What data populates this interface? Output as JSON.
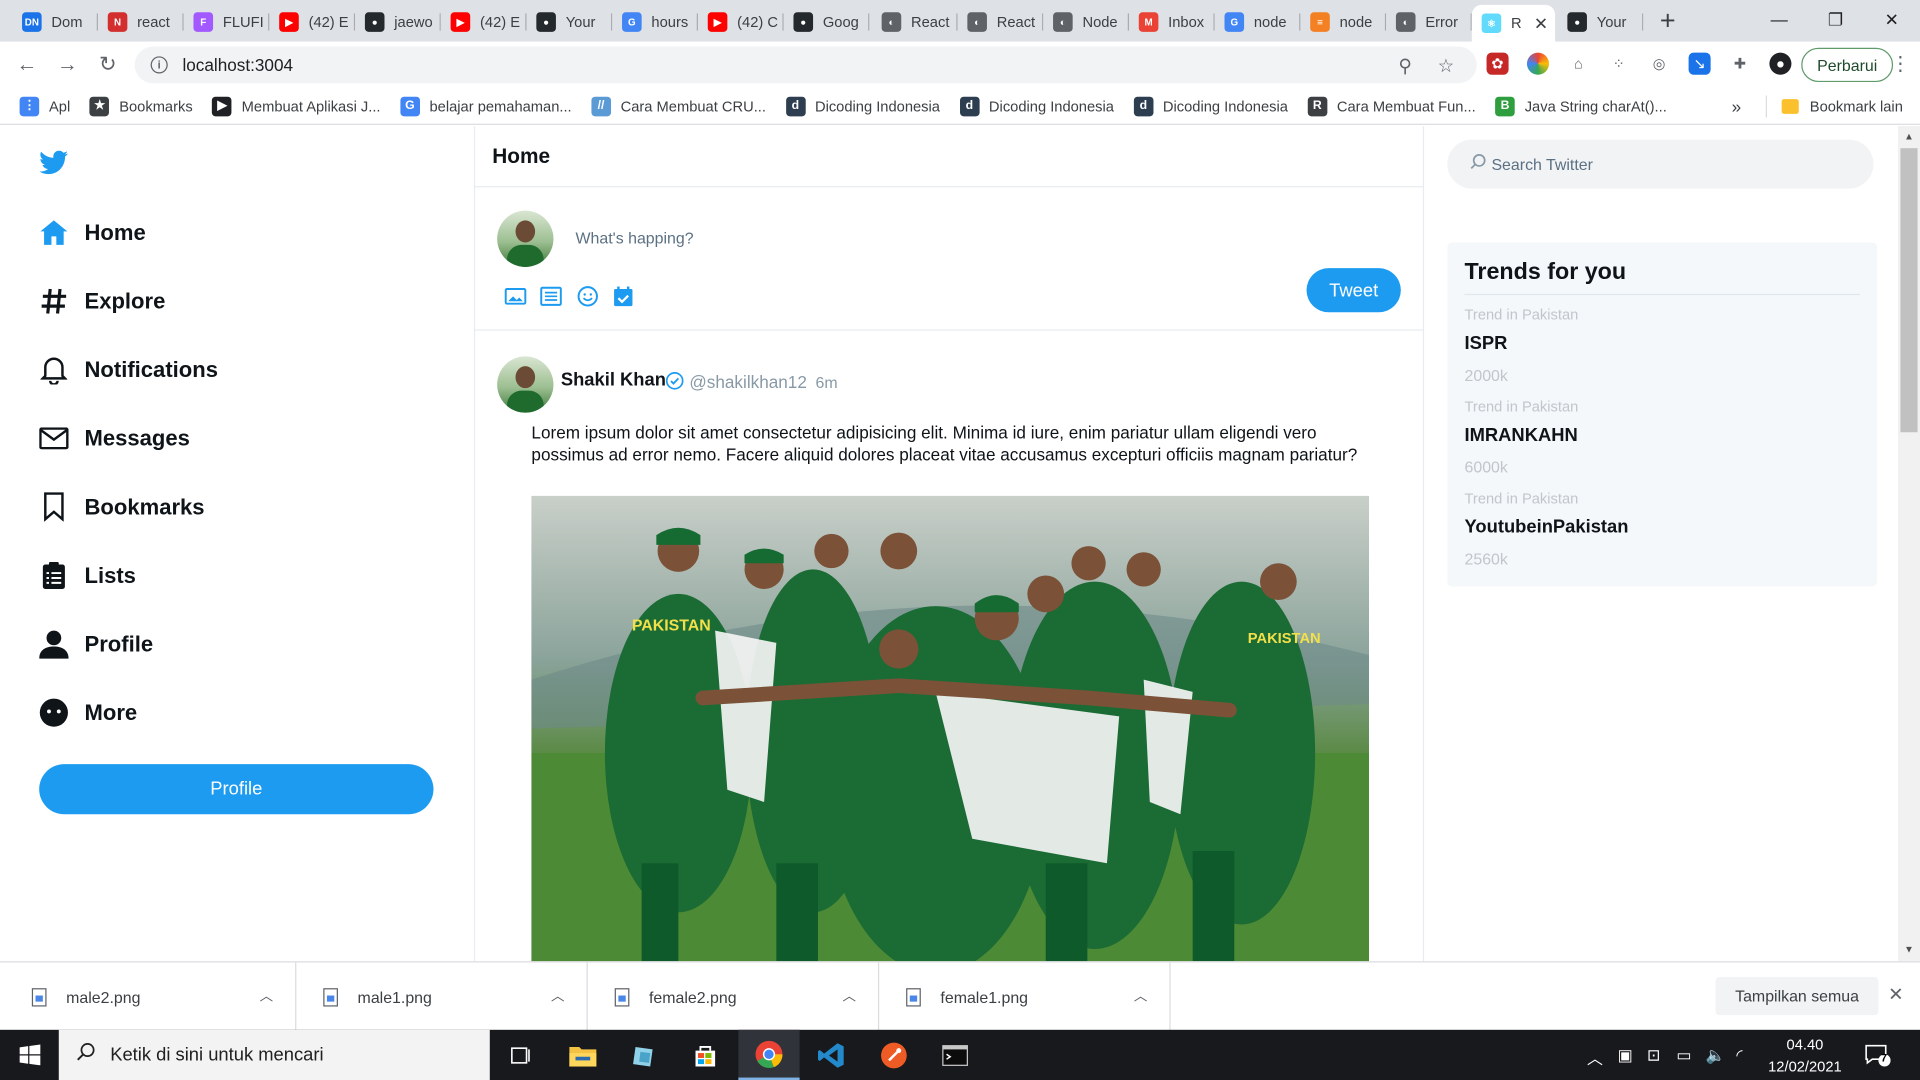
{
  "browser": {
    "tabs": [
      {
        "label": "Dom",
        "color": "#1a73e8",
        "glyph": "DN"
      },
      {
        "label": "react",
        "color": "#d32f2f",
        "glyph": "N"
      },
      {
        "label": "FLUFI",
        "color": "#a259ff",
        "glyph": "F"
      },
      {
        "label": "(42) E",
        "color": "#ff0000",
        "glyph": "▶"
      },
      {
        "label": "jaewo",
        "color": "#24292e",
        "glyph": "●"
      },
      {
        "label": "(42) E",
        "color": "#ff0000",
        "glyph": "▶"
      },
      {
        "label": "Your",
        "color": "#24292e",
        "glyph": "●"
      },
      {
        "label": "hours",
        "color": "#4285f4",
        "glyph": "G"
      },
      {
        "label": "(42) C",
        "color": "#ff0000",
        "glyph": "▶"
      },
      {
        "label": "Goog",
        "color": "#24292e",
        "glyph": "●"
      },
      {
        "label": "React",
        "color": "#5f6368",
        "glyph": "◐"
      },
      {
        "label": "React",
        "color": "#5f6368",
        "glyph": "◐"
      },
      {
        "label": "Node",
        "color": "#5f6368",
        "glyph": "◐"
      },
      {
        "label": "Inbox",
        "color": "#ea4335",
        "glyph": "M"
      },
      {
        "label": "node",
        "color": "#4285f4",
        "glyph": "G"
      },
      {
        "label": "node",
        "color": "#f48024",
        "glyph": "≡"
      },
      {
        "label": "Error",
        "color": "#5f6368",
        "glyph": "◐"
      },
      {
        "label": "R",
        "color": "#61dafb",
        "glyph": "⚛"
      },
      {
        "label": "Your",
        "color": "#24292e",
        "glyph": "●"
      }
    ],
    "url": "localhost:3004",
    "update_label": "Perbarui",
    "bookmarks": [
      {
        "label": "Apl",
        "color": "#4285f4",
        "glyph": "⋮"
      },
      {
        "label": "Bookmarks",
        "color": "#3c4043",
        "glyph": "★"
      },
      {
        "label": "Membuat Aplikasi J...",
        "color": "#202124",
        "glyph": "▶"
      },
      {
        "label": "belajar pemahaman...",
        "color": "#4285f4",
        "glyph": "G"
      },
      {
        "label": "Cara Membuat CRU...",
        "color": "#5b9bd5",
        "glyph": "//"
      },
      {
        "label": "Dicoding Indonesia",
        "color": "#2d3e50",
        "glyph": "d"
      },
      {
        "label": "Dicoding Indonesia",
        "color": "#2d3e50",
        "glyph": "d"
      },
      {
        "label": "Dicoding Indonesia",
        "color": "#2d3e50",
        "glyph": "d"
      },
      {
        "label": "Cara Membuat Fun...",
        "color": "#3c4043",
        "glyph": "R"
      },
      {
        "label": "Java String charAt()...",
        "color": "#2e9e3e",
        "glyph": "B"
      }
    ],
    "bookmarks_more": "»",
    "other_bookmarks": "Bookmark lain"
  },
  "sidebar": {
    "items": [
      {
        "label": "Home",
        "icon": "home-icon"
      },
      {
        "label": "Explore",
        "icon": "hashtag-icon"
      },
      {
        "label": "Notifications",
        "icon": "bell-icon"
      },
      {
        "label": "Messages",
        "icon": "mail-icon"
      },
      {
        "label": "Bookmarks",
        "icon": "bookmark-icon"
      },
      {
        "label": "Lists",
        "icon": "list-icon"
      },
      {
        "label": "Profile",
        "icon": "user-icon"
      },
      {
        "label": "More",
        "icon": "more-icon"
      }
    ],
    "button_label": "Profile"
  },
  "feed": {
    "title": "Home",
    "composer_placeholder": "What's happing?",
    "tweet_button": "Tweet",
    "post": {
      "name": "Shakil Khan",
      "handle": "@shakilkhan12",
      "time": "6m",
      "text": "Lorem ipsum dolor sit amet consectetur adipisicing elit. Minima id iure, enim pariatur ullam eligendi vero possimus ad error nemo. Facere aliquid dolores placeat vitae accusamus excepturi officiis magnam pariatur?",
      "jersey_text": "PAKISTAN"
    }
  },
  "right": {
    "search_placeholder": "Search Twitter",
    "trends_title": "Trends for you",
    "trends": [
      {
        "category": "Trend in Pakistan",
        "name": "ISPR",
        "count": "2000k"
      },
      {
        "category": "Trend in Pakistan",
        "name": "IMRANKAHN",
        "count": "6000k"
      },
      {
        "category": "Trend in Pakistan",
        "name": "YoutubeinPakistan",
        "count": "2560k"
      }
    ]
  },
  "downloads": {
    "files": [
      "male2.png",
      "male1.png",
      "female2.png",
      "female1.png"
    ],
    "show_all": "Tampilkan semua"
  },
  "taskbar": {
    "search_placeholder": "Ketik di sini untuk mencari",
    "time": "04.40",
    "date": "12/02/2021",
    "notification_count": "7"
  },
  "colors": {
    "brand": "#1d9bf0",
    "text": "#0f1419",
    "muted": "#5b7083"
  }
}
